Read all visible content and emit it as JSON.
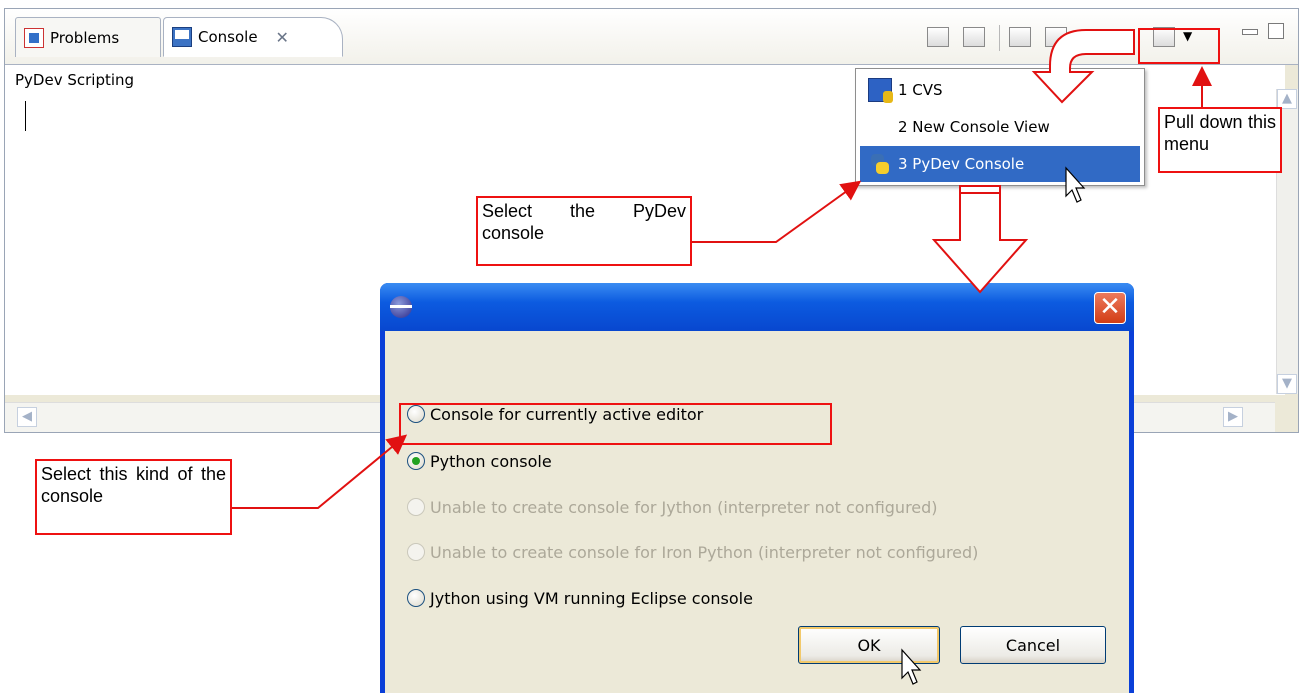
{
  "view": {
    "tabs": [
      {
        "label": "Problems",
        "icon": "problems-icon",
        "active": false
      },
      {
        "label": "Console",
        "icon": "console-icon",
        "active": true
      }
    ],
    "close_glyph": "✕",
    "console_name": "PyDev Scripting"
  },
  "menu": {
    "items": [
      {
        "label": "1 CVS",
        "icon": "cvs-icon"
      },
      {
        "label": "2 New Console View",
        "icon": ""
      },
      {
        "label": "3 PyDev Console",
        "icon": "python-icon",
        "selected": true
      }
    ],
    "selection_color": "#316ac5"
  },
  "annotations": {
    "pull_menu": "Pull down this menu",
    "select_pydev": "Select the PyDev console",
    "select_kind": "Select this kind of the console",
    "color": "#e11111"
  },
  "dialog": {
    "close_glyph": "✕",
    "options": [
      {
        "label": "Console for currently active editor",
        "checked": false,
        "enabled": true
      },
      {
        "label": "Python console",
        "checked": true,
        "enabled": true
      },
      {
        "label": "Unable to create console for Jython (interpreter not configured)",
        "checked": false,
        "enabled": false
      },
      {
        "label": "Unable to create console for Iron Python (interpreter not configured)",
        "checked": false,
        "enabled": false
      },
      {
        "label": "Jython using VM running Eclipse console",
        "checked": false,
        "enabled": true
      }
    ],
    "ok_label": "OK",
    "cancel_label": "Cancel"
  }
}
